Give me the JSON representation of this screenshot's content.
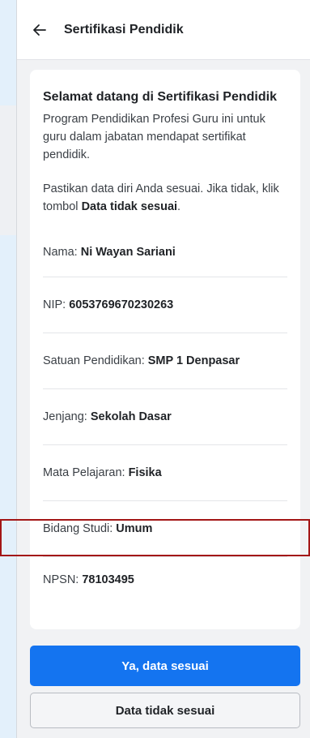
{
  "header": {
    "title": "Sertifikasi Pendidik",
    "back_icon": "arrow-left-icon"
  },
  "card": {
    "title": "Selamat datang di Sertifikasi Pendidik",
    "intro": "Program Pendidikan Profesi Guru ini untuk guru dalam jabatan mendapat sertifikat pendidik.",
    "notice_prefix": "Pastikan data diri Anda sesuai. Jika tidak, klik tombol ",
    "notice_bold": "Data tidak sesuai",
    "notice_suffix": ".",
    "fields": [
      {
        "label": "Nama:",
        "value": "Ni Wayan Sariani"
      },
      {
        "label": "NIP:",
        "value": "6053769670230263"
      },
      {
        "label": "Satuan Pendidikan:",
        "value": "SMP 1 Denpasar"
      },
      {
        "label": "Jenjang:",
        "value": "Sekolah Dasar"
      },
      {
        "label": "Mata Pelajaran:",
        "value": "Fisika"
      },
      {
        "label": "Bidang Studi:",
        "value": "Umum"
      },
      {
        "label": "NPSN:",
        "value": "78103495"
      }
    ]
  },
  "actions": {
    "confirm_label": "Ya, data sesuai",
    "reject_label": "Data tidak sesuai"
  },
  "colors": {
    "primary": "#1474f0",
    "highlight": "#a31616"
  }
}
